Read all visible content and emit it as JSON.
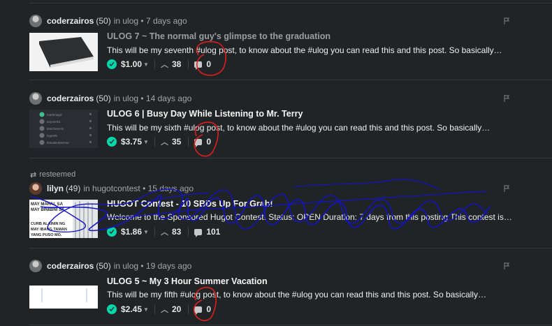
{
  "posts": [
    {
      "author": "coderzairos",
      "reputation": "(50)",
      "meta": "in ulog • 7 days ago",
      "title": "ULOG 7 ~ The normal guy's glimpse to the graduation",
      "summary": "This will be my seventh #ulog post, to know about the #ulog you can read this and this post. So basically…",
      "payout": "$1.00",
      "votes": "38",
      "comments": "0"
    },
    {
      "author": "coderzairos",
      "reputation": "(50)",
      "meta": "in ulog • 14 days ago",
      "title": "ULOG 6 | Busy Day While Listening to Mr. Terry",
      "summary": "This will be my sixth #ulog post, to know about the #ulog you can read this and this post. So basically…",
      "payout": "$3.75",
      "votes": "35",
      "comments": "0",
      "thumb_lines": [
        "markmagic",
        "anyone01",
        "tiancheemin",
        "hype05",
        "titanaleukserme"
      ]
    },
    {
      "resteemed_label": "resteemed",
      "author": "lilyn",
      "reputation": "(49)",
      "meta": "in hugotcontest • 15 days ago",
      "title": "HUGOT Contest - 10 SBDs Up For Grab!",
      "summary": "Welcome to the Sponsored Hugot Contest! Status: OPEN Duration: 7 days from this posting This contest is…",
      "payout": "$1.86",
      "votes": "83",
      "comments": "101",
      "thumb_lines": [
        "MAY MAHAL SA",
        "MAY BINIBINI SA",
        "CURB ALAININ NG",
        "MAY IBANG TAMAN",
        "YANG PUSO MO."
      ]
    },
    {
      "author": "coderzairos",
      "reputation": "(50)",
      "meta": "in ulog • 19 days ago",
      "title": "ULOG 5 ~ My 3 Hour Summer Vacation",
      "summary": "This will be my fifth #ulog post, to know about the #ulog you can read this and this post. So basically…",
      "payout": "$2.45",
      "votes": "20",
      "comments": "0"
    }
  ],
  "colors": {
    "background": "#202427",
    "accent": "#07d7a9",
    "annotation_red": "#e01e1e",
    "annotation_blue": "#1414c8"
  },
  "icons": {
    "flag": "flag-icon",
    "vote": "upvote-chevron-icon",
    "comment": "comment-icon",
    "resteem": "resteem-icon",
    "coin": "steem-coin-icon"
  }
}
